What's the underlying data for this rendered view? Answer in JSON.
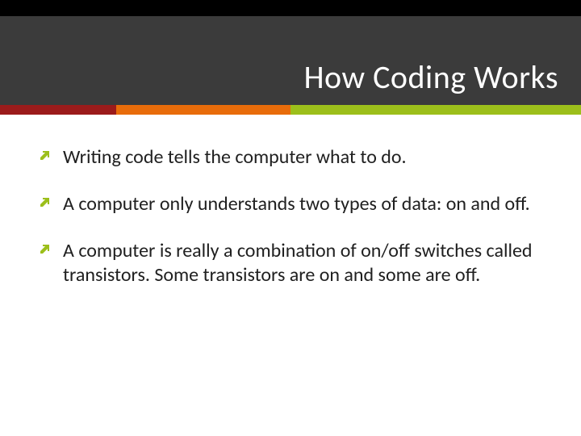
{
  "title": "How Coding Works",
  "accent_segments": [
    {
      "color": "#9b1b1b",
      "width_pct": 20
    },
    {
      "color": "#e86c0a",
      "width_pct": 30
    },
    {
      "color": "#9cbf1b",
      "width_pct": 50
    }
  ],
  "bullet_arrow_color": "#9cbf1b",
  "bullets": [
    "Writing code tells the computer what to do.",
    "A computer only understands two types of data:   on and off.",
    "A computer is really a combination of on/off switches called transistors.  Some transistors are on and some are off."
  ]
}
